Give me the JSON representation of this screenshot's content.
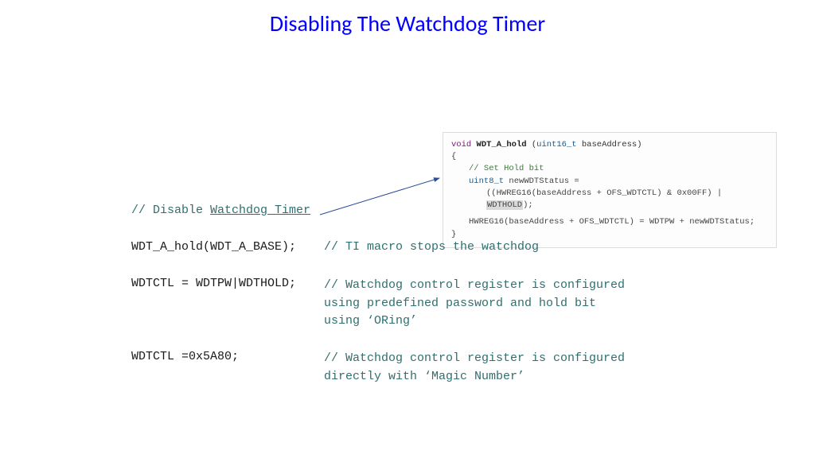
{
  "title": "Disabling The Watchdog Timer",
  "snippet": {
    "kw_void": "void",
    "fn": "WDT_A_hold",
    "paren_open": " (",
    "type": "uint16_t",
    "param": " baseAddress)",
    "brace_open": "{",
    "comment": "// Set Hold bit",
    "line_type": "uint8_t",
    "line_var": " newWDTStatus =",
    "expr_a": "((HWREG16(baseAddress + OFS_WDTCTL) & 0x00FF) | ",
    "expr_hl": "WDTHOLD",
    "expr_tail": ");",
    "assign": "HWREG16(baseAddress + OFS_WDTCTL) = WDTPW + newWDTStatus;",
    "brace_close": "}"
  },
  "left": {
    "disable_prefix": "// Disable ",
    "disable_link": "Watchdog Timer",
    "row1": "WDT_A_hold(WDT_A_BASE);",
    "row2": "WDTCTL = WDTPW|WDTHOLD;",
    "row3": "WDTCTL =0x5A80;"
  },
  "right": {
    "row1": "// TI macro stops the watchdog",
    "row2_l1": "// Watchdog control register is configured",
    "row2_l2": "using predefined password and hold bit",
    "row2_l3": "using ‘ORing’",
    "row3_l1": "// Watchdog control register is configured",
    "row3_l2": "directly with ‘Magic Number’"
  }
}
